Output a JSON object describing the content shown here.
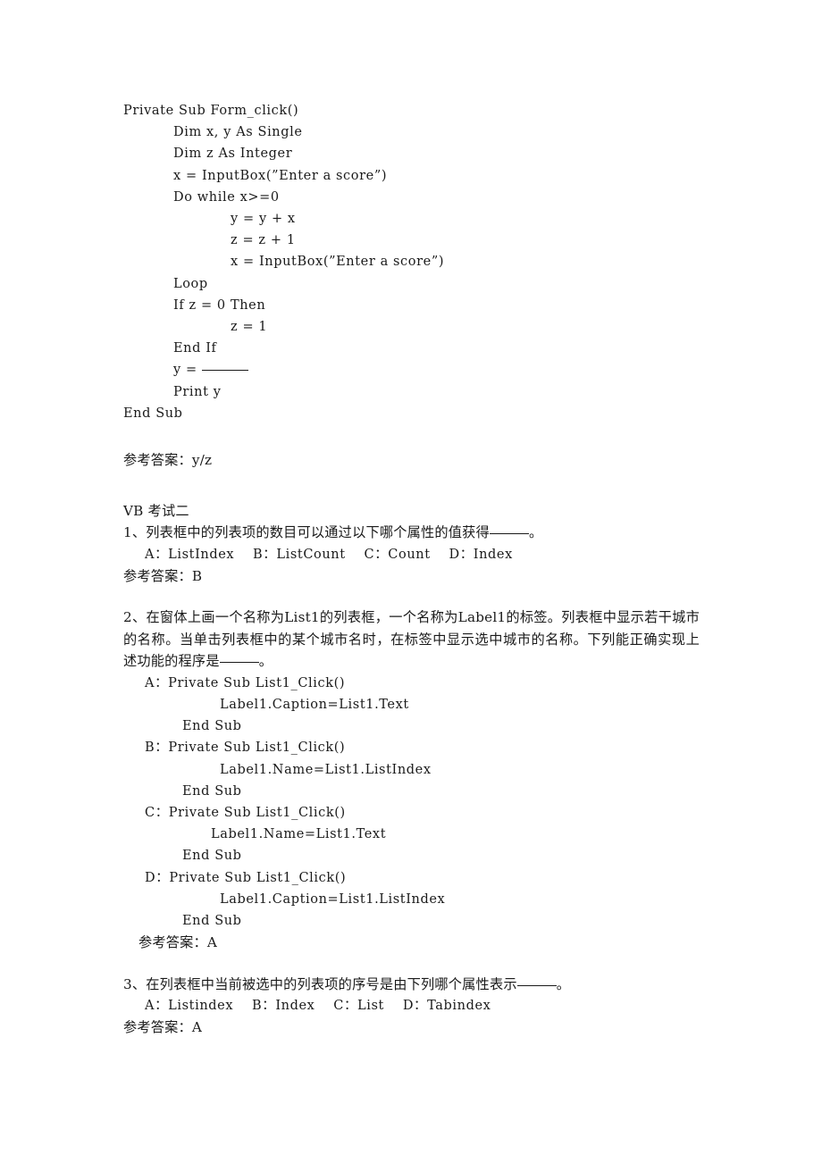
{
  "document": {
    "code_block_1": {
      "lines": [
        {
          "indent": 0,
          "text": "Private Sub Form_click()"
        },
        {
          "indent": 1,
          "text": "Dim x, y As Single"
        },
        {
          "indent": 1,
          "text": "Dim z As Integer"
        },
        {
          "indent": 1,
          "text": "x = InputBox(”Enter a score”)"
        },
        {
          "indent": 1,
          "text": "Do while x>=0"
        },
        {
          "indent": 2,
          "text": "y = y + x"
        },
        {
          "indent": 2,
          "text": "z = z + 1"
        },
        {
          "indent": 2,
          "text": "x = InputBox(”Enter a score”)"
        },
        {
          "indent": 1,
          "text": "Loop"
        },
        {
          "indent": 1,
          "text": "If z = 0 Then"
        },
        {
          "indent": 2,
          "text": "z = 1"
        },
        {
          "indent": 1,
          "text": "End If"
        },
        {
          "indent": 1,
          "text": "y = ",
          "blank": true
        },
        {
          "indent": 1,
          "text": "Print y"
        },
        {
          "indent": 0,
          "text": "End Sub"
        }
      ]
    },
    "answer_0": "参考答案：y/z",
    "section_title": "VB 考试二",
    "q1": {
      "stem_before": "1、列表框中的列表项的数目可以通过以下哪个属性的值获得",
      "stem_after": "。",
      "options": "A：ListIndex    B：ListCount    C：Count    D：Index",
      "answer": "参考答案：B"
    },
    "q2": {
      "stem": "2、在窗体上画一个名称为List1的列表框，一个名称为Label1的标签。列表框中显示若干城市的名称。当单击列表框中的某个城市名时，在标签中显示选中城市的名称。下列能正确实现上述功能的程序是",
      "stem_after": "。",
      "option_a": {
        "head": "A：Private Sub List1_Click()",
        "body": "Label1.Caption=List1.Text",
        "end": "End Sub"
      },
      "option_b": {
        "head": "B：Private Sub List1_Click()",
        "body": "Label1.Name=List1.ListIndex",
        "end": "End Sub"
      },
      "option_c": {
        "head": "C：Private Sub List1_Click()",
        "body": "Label1.Name=List1.Text",
        "end": "End Sub"
      },
      "option_d": {
        "head": "D：Private Sub List1_Click()",
        "body": "Label1.Caption=List1.ListIndex",
        "end": "End Sub"
      },
      "answer": "参考答案：A"
    },
    "q3": {
      "stem_before": "3、在列表框中当前被选中的列表项的序号是由下列哪个属性表示",
      "stem_after": "。",
      "options": "A：Listindex    B：Index    C：List    D：Tabindex",
      "answer": "参考答案：A"
    }
  }
}
